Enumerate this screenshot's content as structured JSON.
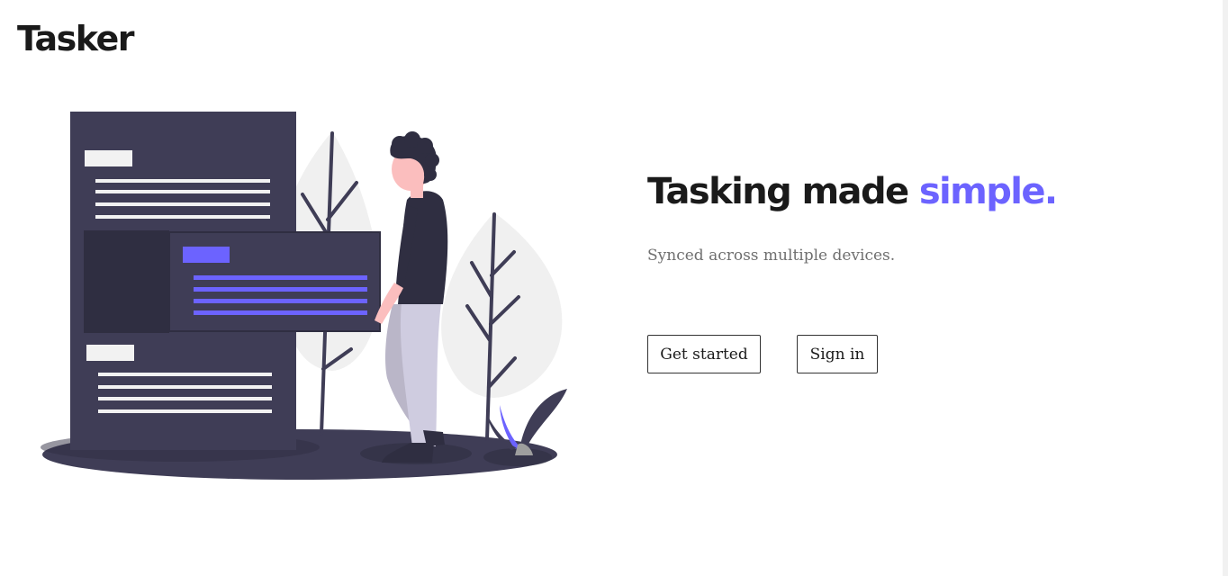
{
  "header": {
    "logo_text": "Tasker"
  },
  "hero": {
    "title_main": "Tasking made ",
    "title_accent": "simple.",
    "subtitle": "Synced across multiple devices.",
    "primary_button_label": "Get started",
    "secondary_button_label": "Sign in"
  },
  "illustration": {
    "name": "person-with-task-board-illustration"
  },
  "colors": {
    "accent": "#6c63ff",
    "dark_panel": "#3f3d56",
    "text": "#1a1a1a",
    "muted_text": "#6f6f6f"
  }
}
